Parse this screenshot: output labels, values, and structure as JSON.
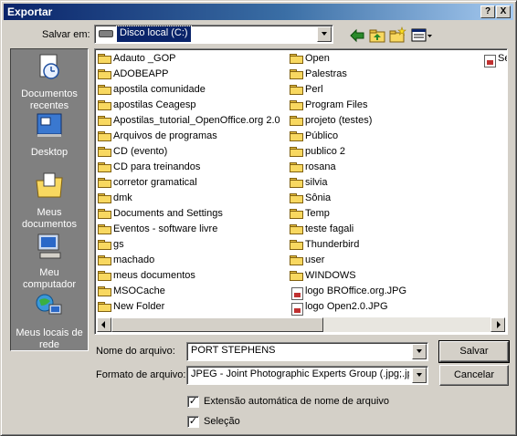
{
  "window": {
    "title": "Exportar"
  },
  "titlebar_buttons": {
    "help": "?",
    "close": "X"
  },
  "save_in": {
    "label": "Salvar em:",
    "value": "Disco local (C:)"
  },
  "places": [
    {
      "label_line1": "Documentos",
      "label_line2": "recentes",
      "icon": "recent-documents-icon"
    },
    {
      "label_line1": "Desktop",
      "label_line2": "",
      "icon": "desktop-icon"
    },
    {
      "label_line1": "Meus",
      "label_line2": "documentos",
      "icon": "my-documents-icon"
    },
    {
      "label_line1": "Meu",
      "label_line2": "computador",
      "icon": "my-computer-icon"
    },
    {
      "label_line1": "Meus locais de",
      "label_line2": "rede",
      "icon": "network-places-icon"
    }
  ],
  "files": {
    "column1": [
      "Adauto _GOP",
      "ADOBEAPP",
      "apostila comunidade",
      "apostilas Ceagesp",
      "Apostilas_tutorial_OpenOffice.org 2.0",
      "Arquivos de programas",
      "CD (evento)",
      "CD para treinandos",
      "corretor gramatical",
      "dmk",
      "Documents and Settings",
      "Eventos - software livre",
      "gs",
      "machado",
      "meus documentos",
      "MSOCache",
      "New Folder"
    ],
    "column2": [
      {
        "name": "Open",
        "type": "folder"
      },
      {
        "name": "Palestras",
        "type": "folder"
      },
      {
        "name": "Perl",
        "type": "folder"
      },
      {
        "name": "Program Files",
        "type": "folder"
      },
      {
        "name": "projeto (testes)",
        "type": "folder"
      },
      {
        "name": "Público",
        "type": "folder"
      },
      {
        "name": "publico 2",
        "type": "folder"
      },
      {
        "name": "rosana",
        "type": "folder"
      },
      {
        "name": "silvia",
        "type": "folder"
      },
      {
        "name": "Sônia",
        "type": "folder"
      },
      {
        "name": "Temp",
        "type": "folder"
      },
      {
        "name": "teste fagali",
        "type": "folder"
      },
      {
        "name": "Thunderbird",
        "type": "folder"
      },
      {
        "name": "user",
        "type": "folder"
      },
      {
        "name": "WINDOWS",
        "type": "folder"
      },
      {
        "name": "logo BROffice.org.JPG",
        "type": "jpg"
      },
      {
        "name": "logo Open2.0.JPG",
        "type": "jpg"
      }
    ],
    "column3": [
      {
        "name": "Se",
        "type": "jpg"
      }
    ]
  },
  "filename": {
    "label": "Nome do arquivo:",
    "value": "PORT STEPHENS"
  },
  "format": {
    "label": "Formato de arquivo:",
    "value": "JPEG - Joint Photographic Experts Group (.jpg;.jpeg"
  },
  "buttons": {
    "save": "Salvar",
    "cancel": "Cancelar"
  },
  "options": {
    "auto_extension": {
      "label": "Extensão automática de nome de arquivo",
      "checked": true
    },
    "selection": {
      "label": "Seleção",
      "checked": true
    }
  },
  "colors": {
    "title_start": "#0a246a",
    "title_end": "#a6caf0",
    "dialog_bg": "#d4d0c8",
    "places_bg": "#808080",
    "selection": "#0a246a"
  }
}
